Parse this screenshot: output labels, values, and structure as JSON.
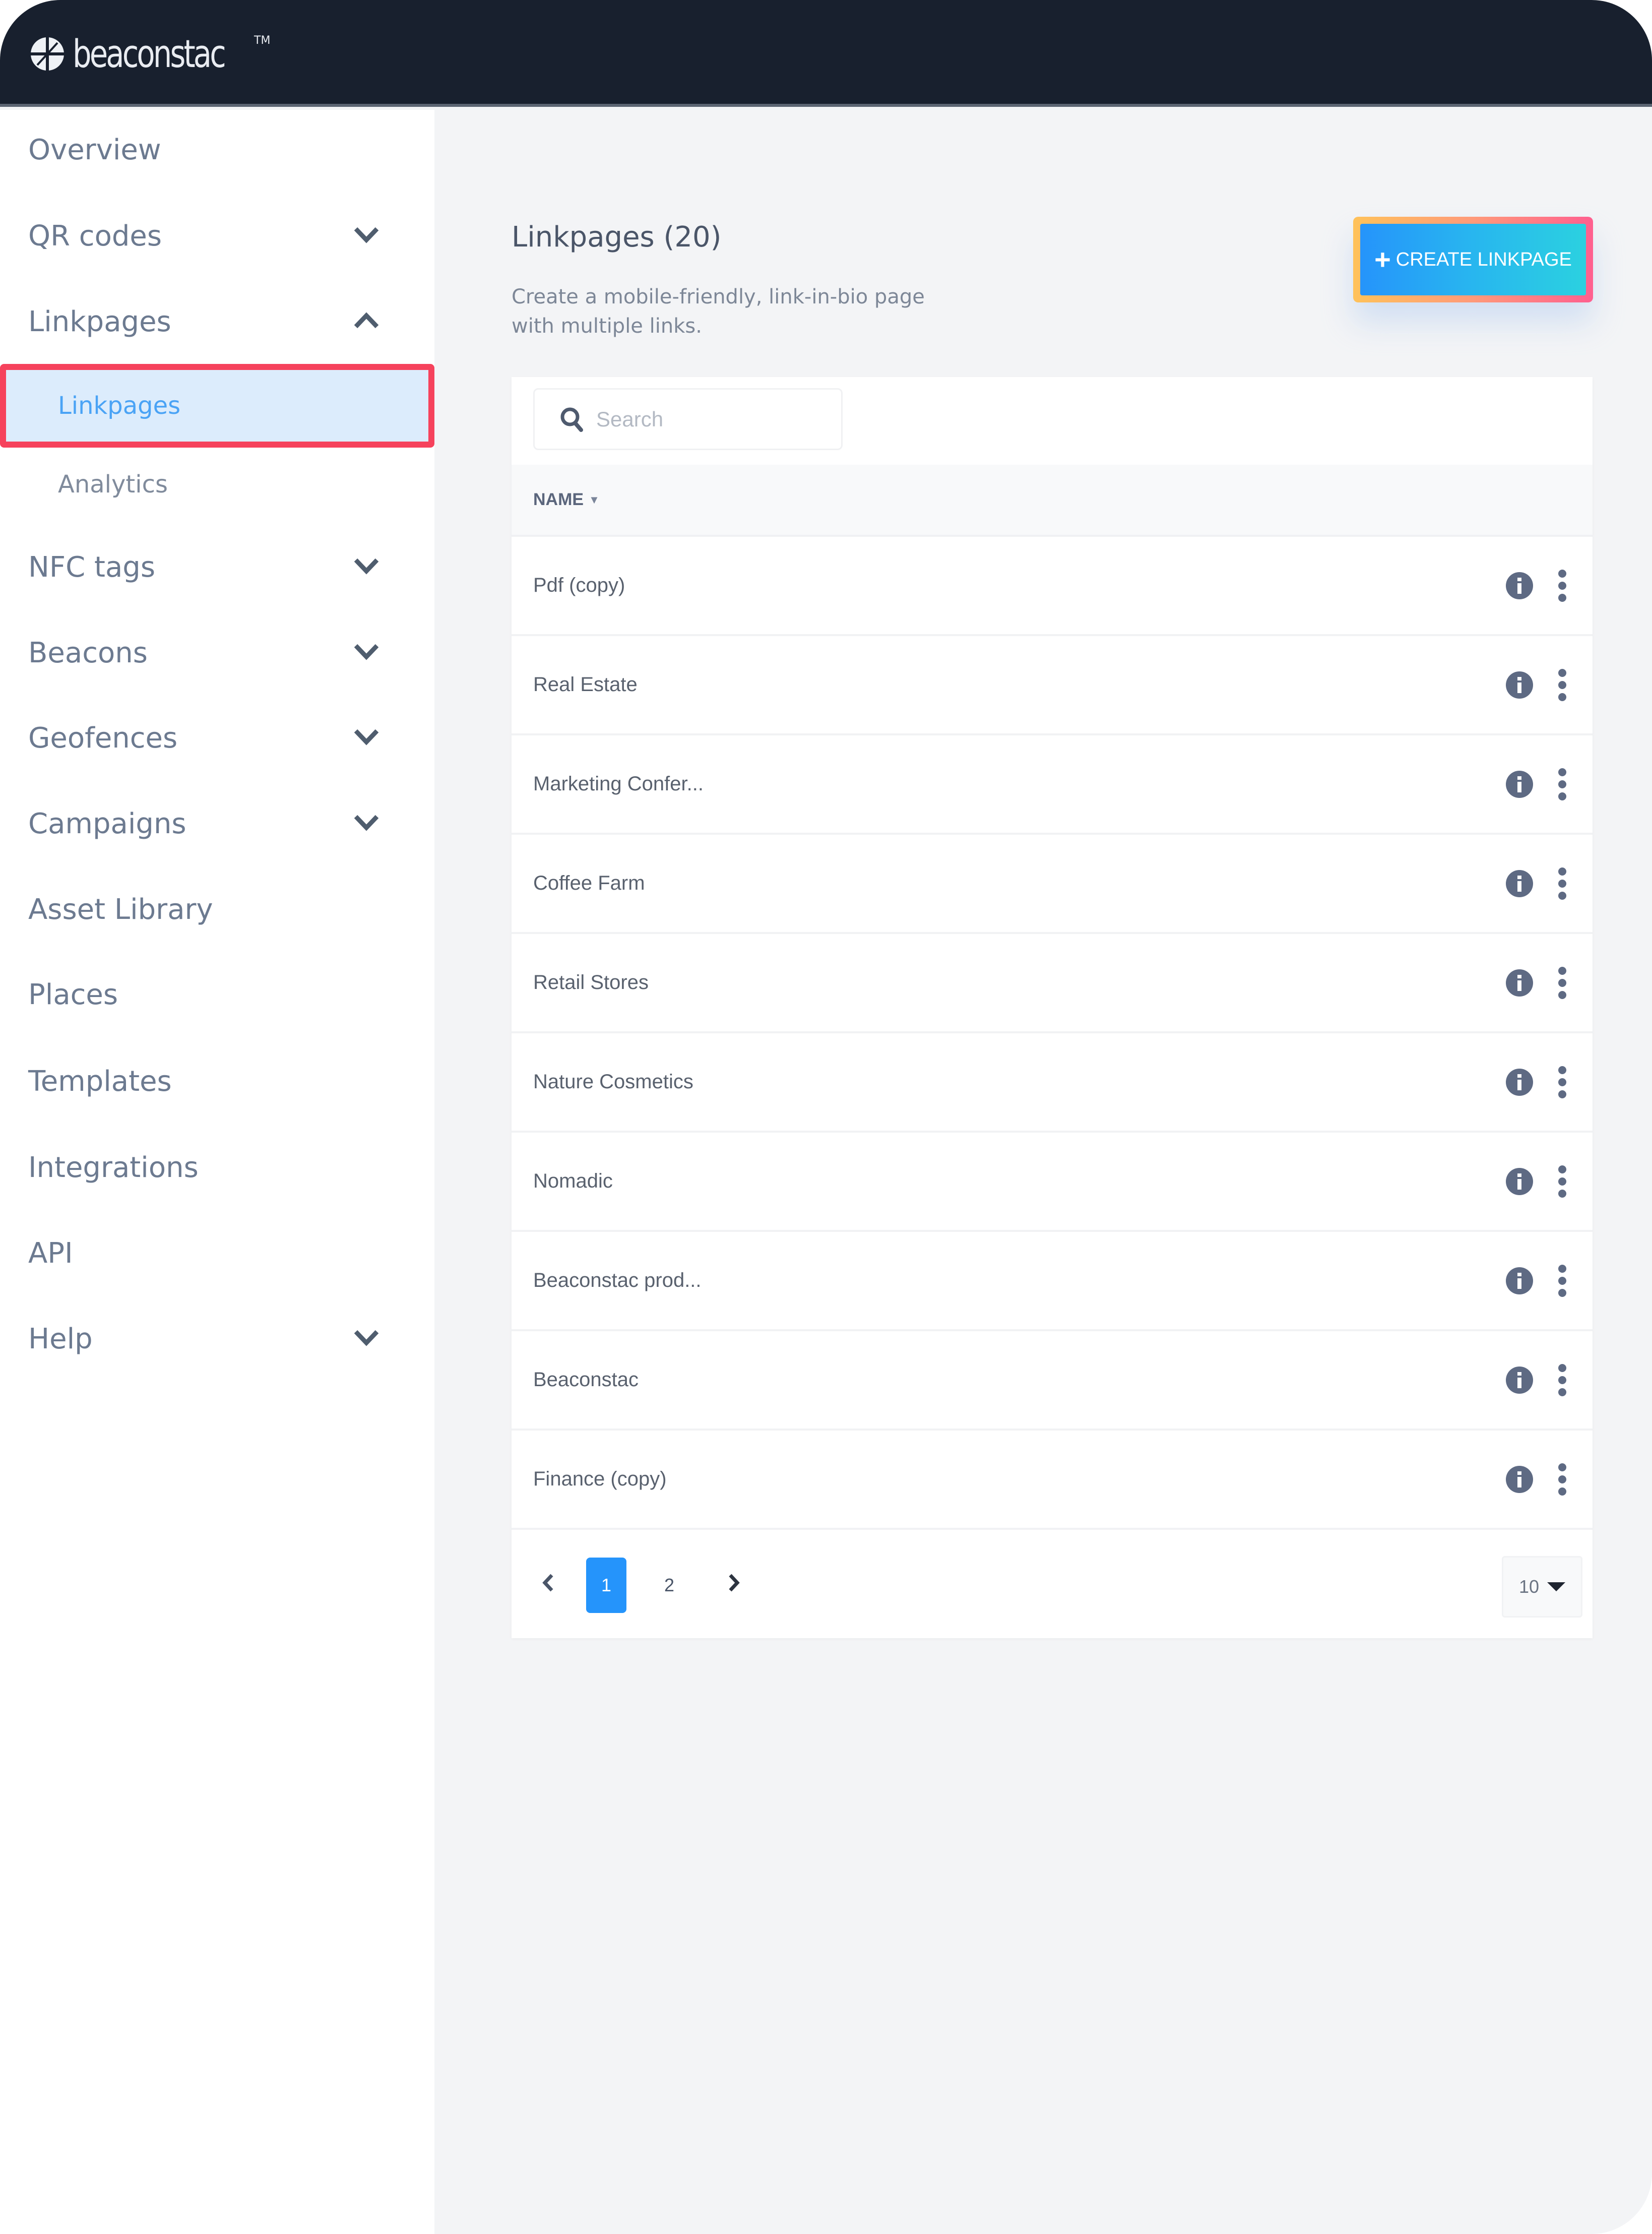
{
  "app": {
    "brand": "beaconstac",
    "trademark": "TM"
  },
  "sidebar": {
    "items": [
      {
        "label": "Overview",
        "chevron": null
      },
      {
        "label": "QR codes",
        "chevron": "down"
      },
      {
        "label": "Linkpages",
        "chevron": "up",
        "children": [
          {
            "label": "Linkpages",
            "active": true
          },
          {
            "label": "Analytics",
            "active": false
          }
        ]
      },
      {
        "label": "NFC tags",
        "chevron": "down"
      },
      {
        "label": "Beacons",
        "chevron": "down"
      },
      {
        "label": "Geofences",
        "chevron": "down"
      },
      {
        "label": "Campaigns",
        "chevron": "down"
      },
      {
        "label": "Asset Library",
        "chevron": null
      },
      {
        "label": "Places",
        "chevron": null
      },
      {
        "label": "Templates",
        "chevron": null
      },
      {
        "label": "Integrations",
        "chevron": null
      },
      {
        "label": "API",
        "chevron": null
      },
      {
        "label": "Help",
        "chevron": "down"
      }
    ]
  },
  "main": {
    "title": "Linkpages (20)",
    "description": "Create a mobile-friendly, link-in-bio page with multiple links.",
    "create_button": {
      "icon": "plus-icon",
      "label": "CREATE LINKPAGE"
    },
    "search": {
      "placeholder": "Search",
      "value": ""
    },
    "table": {
      "columns": [
        {
          "label": "NAME",
          "sort": "descending"
        }
      ],
      "rows": [
        {
          "name": "Pdf (copy)"
        },
        {
          "name": "Real Estate"
        },
        {
          "name": "Marketing Confer..."
        },
        {
          "name": "Coffee Farm"
        },
        {
          "name": "Retail Stores"
        },
        {
          "name": "Nature Cosmetics"
        },
        {
          "name": "Nomadic"
        },
        {
          "name": "Beaconstac prod..."
        },
        {
          "name": "Beaconstac"
        },
        {
          "name": "Finance (copy)"
        }
      ],
      "row_actions": [
        "info-icon",
        "more-vertical-icon"
      ]
    },
    "pagination": {
      "pages": [
        "1",
        "2"
      ],
      "current": "1",
      "per_page": "10"
    }
  },
  "colors": {
    "topbar": "#18202e",
    "accent": "#2594fb",
    "highlight_border": "#f6425c",
    "active_bg": "#dcecfc",
    "icon": "#5e6a83"
  }
}
